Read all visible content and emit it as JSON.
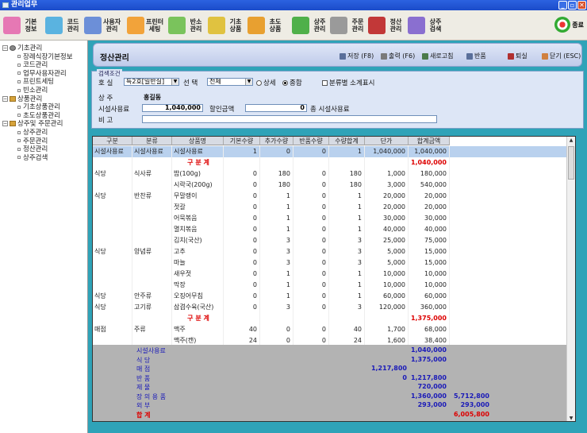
{
  "window": {
    "title": "관리업무"
  },
  "toolbar": [
    {
      "label": "기본\n정보",
      "color": "#e678b4"
    },
    {
      "label": "코드\n관리",
      "color": "#5ab3e0"
    },
    {
      "label": "사용자\n관리",
      "color": "#6c8fd8"
    },
    {
      "label": "프린터\n세팅",
      "color": "#f2a33a"
    },
    {
      "label": "반소\n관리",
      "color": "#7ac35c"
    },
    {
      "label": "기초\n상품",
      "color": "#e0c240"
    },
    {
      "label": "초도\n상품",
      "color": "#e8a030"
    },
    {
      "label": "상주\n관리",
      "color": "#4fb04a"
    },
    {
      "label": "주문\n관리",
      "color": "#9a9a9a"
    },
    {
      "label": "정산\n관리",
      "color": "#c23838"
    },
    {
      "label": "상주\n검색",
      "color": "#8a6fd0"
    }
  ],
  "exit_label": "종료",
  "tree": [
    {
      "label": "기초관리",
      "level": 0,
      "kind": "root"
    },
    {
      "label": "장례식장기본정보",
      "level": 1
    },
    {
      "label": "코드관리",
      "level": 1
    },
    {
      "label": "업무사용자관리",
      "level": 1
    },
    {
      "label": "프린트세팅",
      "level": 1
    },
    {
      "label": "빈소관리",
      "level": 1
    },
    {
      "label": "상품관리",
      "level": 0,
      "kind": "folder"
    },
    {
      "label": "기초상품관리",
      "level": 1
    },
    {
      "label": "초도상품관리",
      "level": 1
    },
    {
      "label": "상주및 주문관리",
      "level": 0,
      "kind": "folder"
    },
    {
      "label": "상주관리",
      "level": 1
    },
    {
      "label": "주문관리",
      "level": 1
    },
    {
      "label": "정산관리",
      "level": 1
    },
    {
      "label": "상주검색",
      "level": 1
    }
  ],
  "header": {
    "title": "정산관리",
    "buttons": [
      {
        "label": "저장 (F8)",
        "color": "#5a6f9a"
      },
      {
        "label": "출력 (F6)",
        "color": "#7a7a7a"
      },
      {
        "label": "새로고침",
        "color": "#4a7a4a"
      },
      {
        "label": "반품",
        "color": "#5a6f9a"
      },
      {
        "label": "퇴실",
        "color": "#b03030"
      },
      {
        "label": "닫기 (ESC)",
        "color": "#d08040"
      }
    ]
  },
  "search": {
    "legend": "검색조건",
    "room_label": "호  실",
    "room_value": "특2호[일반실]",
    "select_label": "선  택",
    "select_value": "전체",
    "radio_detail": "상세",
    "radio_summary": "종합",
    "checkbox_label": "분류별 소계표시",
    "chief_label": "상      주",
    "chief_value": "홍길동",
    "facility_label": "시설사용료",
    "facility_value": "1,040,000",
    "discount_label": "할인금액",
    "discount_value": "0",
    "total_label": "총 시설사용료",
    "memo_label": "비      고",
    "memo_value": ""
  },
  "grid": {
    "columns": [
      "구분",
      "분류",
      "상품명",
      "기본수량",
      "추가수량",
      "반품수량",
      "수량합계",
      "단가",
      "합계금액"
    ],
    "rows": [
      {
        "c": [
          "시설사용료",
          "시설사용료",
          "시설사용료",
          "1",
          "0",
          "0",
          "1",
          "1,040,000",
          "1,040,000"
        ],
        "selected": true
      },
      {
        "c": [
          "",
          "",
          "구 분 계",
          "",
          "",
          "",
          "",
          "",
          "1,040,000"
        ],
        "subtotal": true
      },
      {
        "c": [
          "식당",
          "식사류",
          "밥(100g)",
          "0",
          "180",
          "0",
          "180",
          "1,000",
          "180,000"
        ]
      },
      {
        "c": [
          "",
          "",
          "시락국(200g)",
          "0",
          "180",
          "0",
          "180",
          "3,000",
          "540,000"
        ]
      },
      {
        "c": [
          "식당",
          "반찬류",
          "무말랭이",
          "0",
          "1",
          "0",
          "1",
          "20,000",
          "20,000"
        ]
      },
      {
        "c": [
          "",
          "",
          "젓갈",
          "0",
          "1",
          "0",
          "1",
          "20,000",
          "20,000"
        ]
      },
      {
        "c": [
          "",
          "",
          "어묵볶음",
          "0",
          "1",
          "0",
          "1",
          "30,000",
          "30,000"
        ]
      },
      {
        "c": [
          "",
          "",
          "멸치볶음",
          "0",
          "1",
          "0",
          "1",
          "40,000",
          "40,000"
        ]
      },
      {
        "c": [
          "",
          "",
          "김치(국산)",
          "0",
          "3",
          "0",
          "3",
          "25,000",
          "75,000"
        ]
      },
      {
        "c": [
          "식당",
          "양념류",
          "고추",
          "0",
          "3",
          "0",
          "3",
          "5,000",
          "15,000"
        ]
      },
      {
        "c": [
          "",
          "",
          "마늘",
          "0",
          "3",
          "0",
          "3",
          "5,000",
          "15,000"
        ]
      },
      {
        "c": [
          "",
          "",
          "새우젓",
          "0",
          "1",
          "0",
          "1",
          "10,000",
          "10,000"
        ]
      },
      {
        "c": [
          "",
          "",
          "막장",
          "0",
          "1",
          "0",
          "1",
          "10,000",
          "10,000"
        ]
      },
      {
        "c": [
          "식당",
          "안주류",
          "오징어무침",
          "0",
          "1",
          "0",
          "1",
          "60,000",
          "60,000"
        ]
      },
      {
        "c": [
          "식당",
          "고기류",
          "삼겹수육(국산)",
          "0",
          "3",
          "0",
          "3",
          "120,000",
          "360,000"
        ]
      },
      {
        "c": [
          "",
          "",
          "구 분 계",
          "",
          "",
          "",
          "",
          "",
          "1,375,000"
        ],
        "subtotal": true
      },
      {
        "c": [
          "매점",
          "주류",
          "맥주",
          "40",
          "0",
          "0",
          "40",
          "1,700",
          "68,000"
        ]
      },
      {
        "c": [
          "",
          "",
          "맥주(캔)",
          "24",
          "0",
          "0",
          "24",
          "1,600",
          "38,400"
        ]
      }
    ]
  },
  "summary": [
    {
      "label": "시설사용료",
      "col2": "",
      "col3": "1,040,000",
      "col4": ""
    },
    {
      "label": "식         당",
      "col2": "",
      "col3": "1,375,000",
      "col4": ""
    },
    {
      "label": "매         점",
      "col2": "1,217,800",
      "col3": "",
      "col4": ""
    },
    {
      "label": "반         품",
      "col2": "0",
      "col3": "1,217,800",
      "col4": ""
    },
    {
      "label": "제         물",
      "col2": "",
      "col3": "720,000",
      "col4": ""
    },
    {
      "label": "장 의 용 품",
      "col2": "",
      "col3": "1,360,000",
      "col4": "5,712,800"
    },
    {
      "label": "외         부",
      "col2": "",
      "col3": "293,000",
      "col4": "293,000"
    },
    {
      "label": "합         계",
      "col2": "",
      "col3": "",
      "col4": "6,005,800",
      "total": true
    }
  ]
}
